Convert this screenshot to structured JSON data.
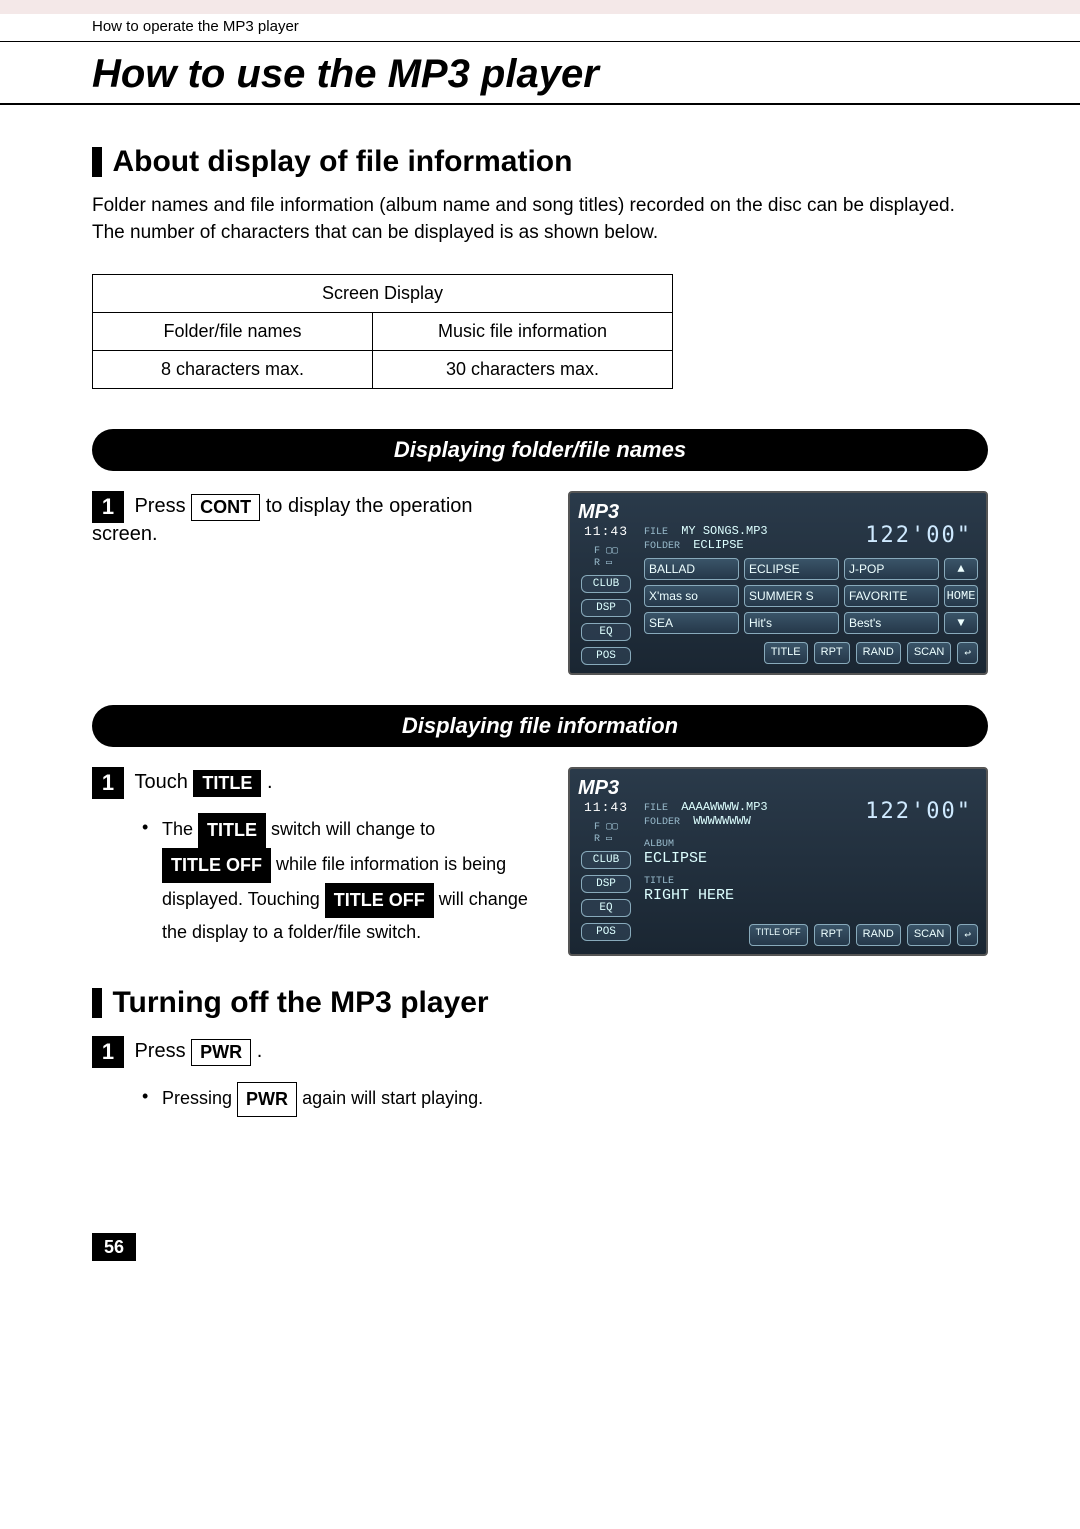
{
  "breadcrumb": "How to operate the MP3 player",
  "page_title": "How to use the MP3 player",
  "page_number": "56",
  "sections": {
    "about": {
      "heading": "About display of file information",
      "body": "Folder names and file information (album name and song titles) recorded on the disc can be displayed.  The number of characters that can be displayed is as shown below.",
      "table": {
        "merged_header": "Screen Display",
        "col1_header": "Folder/file names",
        "col2_header": "Music file information",
        "col1_value": "8 characters max.",
        "col2_value": "30 characters max."
      }
    },
    "folder_names": {
      "pill": "Displaying folder/file names",
      "step_num": "1",
      "step_prefix": "Press ",
      "step_button": "CONT",
      "step_suffix": " to display the operation screen."
    },
    "file_info": {
      "pill": "Displaying file information",
      "step_num": "1",
      "step_prefix": "Touch ",
      "step_button": "TITLE",
      "step_suffix": ".",
      "bullet_a": "The ",
      "bullet_b": "TITLE",
      "bullet_c": " switch will change to ",
      "bullet_d": "TITLE OFF",
      "bullet_e": " while file information is being displayed.  Touching ",
      "bullet_f": "TITLE OFF",
      "bullet_g": " will change the display to a folder/file switch."
    },
    "turn_off": {
      "heading": "Turning off the MP3 player",
      "step_num": "1",
      "step_prefix": "Press ",
      "step_button": "PWR",
      "step_suffix": ".",
      "bullet_a": "Pressing ",
      "bullet_b": "PWR",
      "bullet_c": " again will start playing."
    }
  },
  "screen1": {
    "title": "MP3",
    "time": "11:43",
    "file_label": "FILE",
    "file_value": "MY SONGS.MP3",
    "folder_label": "FOLDER",
    "folder_value": "ECLIPSE",
    "duration": "122'00\"",
    "side_buttons": [
      "CLUB",
      "DSP",
      "EQ",
      "POS"
    ],
    "folders": [
      "BALLAD",
      "ECLIPSE",
      "J-POP",
      "X'mas so",
      "SUMMER S",
      "FAVORITE",
      "SEA",
      "Hit's",
      "Best's"
    ],
    "nav": {
      "up": "▲",
      "home": "HOME",
      "down": "▼"
    },
    "bottom": [
      "TITLE",
      "RPT",
      "RAND",
      "SCAN"
    ],
    "return_icon": "↩"
  },
  "screen2": {
    "title": "MP3",
    "time": "11:43",
    "file_label": "FILE",
    "file_value": "AAAAWWWW.MP3",
    "folder_label": "FOLDER",
    "folder_value": "WWWWWWWW",
    "duration": "122'00\"",
    "album_label": "ALBUM",
    "album_value": "ECLIPSE",
    "title_label": "TITLE",
    "title_value": "RIGHT HERE",
    "side_buttons": [
      "CLUB",
      "DSP",
      "EQ",
      "POS"
    ],
    "bottom": [
      "TITLE OFF",
      "RPT",
      "RAND",
      "SCAN"
    ],
    "return_icon": "↩"
  }
}
